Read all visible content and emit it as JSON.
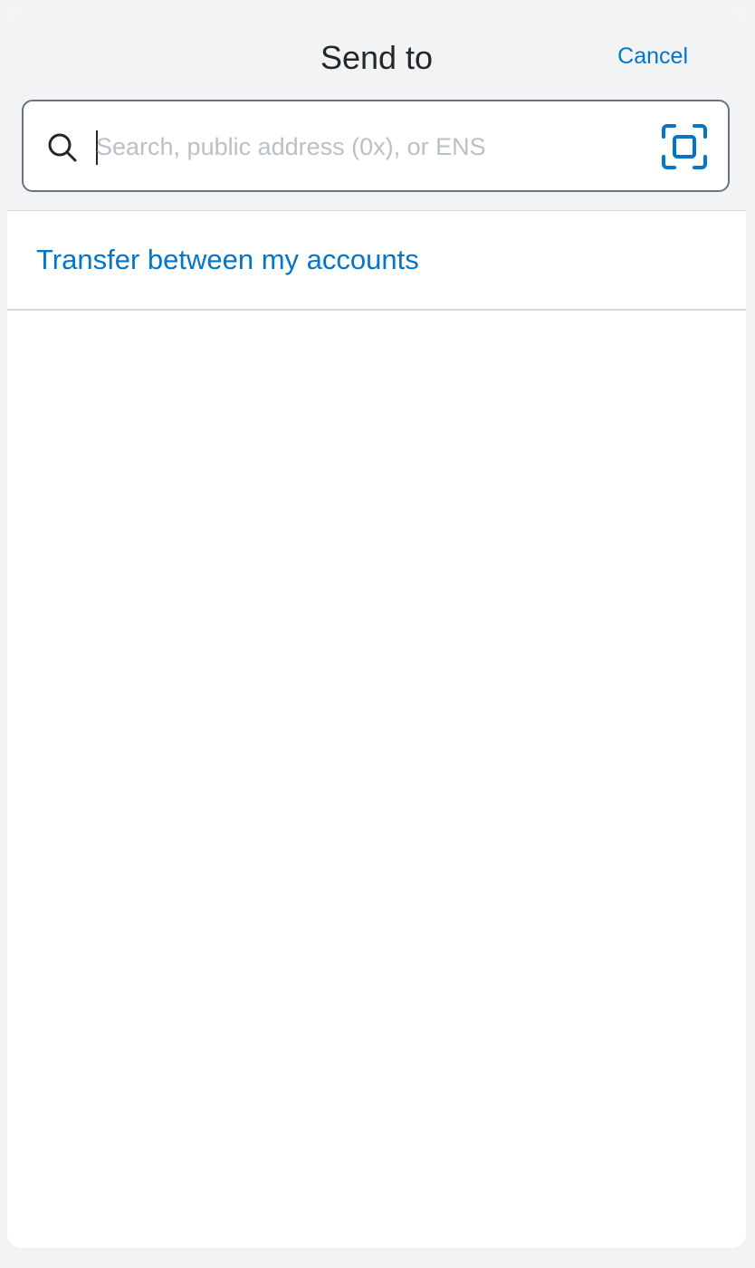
{
  "header": {
    "title": "Send to",
    "cancel_label": "Cancel"
  },
  "search": {
    "value": "",
    "placeholder": "Search, public address (0x), or ENS",
    "icon": "search-icon",
    "scan_icon": "qr-scan-icon"
  },
  "transfer": {
    "label": "Transfer between my accounts"
  },
  "colors": {
    "accent": "#0376c9",
    "background": "#f2f3f4",
    "text": "#24272a",
    "placeholder": "#bbc0c5",
    "divider": "#d6d9dc"
  }
}
